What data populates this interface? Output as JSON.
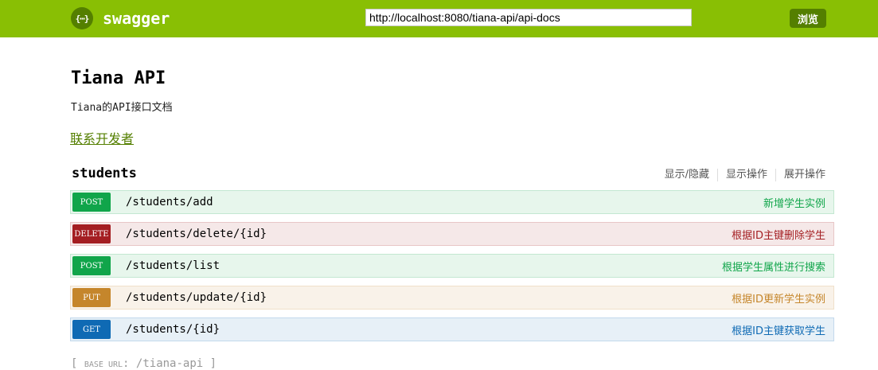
{
  "header": {
    "logo_glyph": "{⋯}",
    "logo_text": "swagger",
    "url_value": "http://localhost:8080/tiana-api/api-docs",
    "explore_label": "浏览",
    "colors": {
      "bar": "#89bf04",
      "button": "#547f00"
    }
  },
  "info": {
    "title": "Tiana API",
    "description": "Tiana的API接口文档",
    "contact_label": "联系开发者"
  },
  "resource": {
    "name": "students",
    "options": [
      "显示/隐藏",
      "显示操作",
      "展开操作"
    ],
    "operations": [
      {
        "method": "POST",
        "path": "/students/add",
        "summary": "新增学生实例"
      },
      {
        "method": "DELETE",
        "path": "/students/delete/{id}",
        "summary": "根据ID主键删除学生"
      },
      {
        "method": "POST",
        "path": "/students/list",
        "summary": "根据学生属性进行搜索"
      },
      {
        "method": "PUT",
        "path": "/students/update/{id}",
        "summary": "根据ID更新学生实例"
      },
      {
        "method": "GET",
        "path": "/students/{id}",
        "summary": "根据ID主键获取学生"
      }
    ]
  },
  "method_colors": {
    "POST": "#10a54a",
    "DELETE": "#a41e22",
    "PUT": "#c5862b",
    "GET": "#0f6ab4"
  },
  "footer": {
    "open_bracket": "[",
    "base_label": "BASE URL",
    "base_value": ": /tiana-api",
    "close_bracket": "]"
  }
}
